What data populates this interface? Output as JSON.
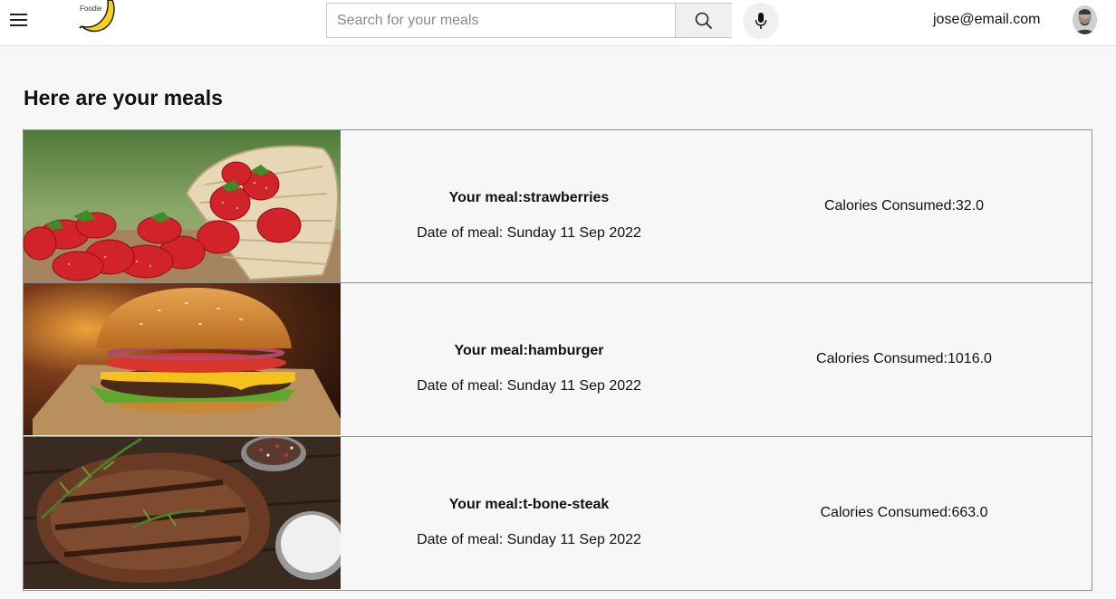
{
  "header": {
    "logo_text": "Foodie",
    "search_placeholder": "Search for your meals",
    "search_value": "",
    "user_email": "jose@email.com"
  },
  "main": {
    "title": "Here are your meals",
    "meals": [
      {
        "name_label": "Your meal:strawberries",
        "date_label": "Date of meal: Sunday 11 Sep 2022",
        "calories_label": "Calories Consumed:32.0"
      },
      {
        "name_label": "Your meal:hamburger",
        "date_label": "Date of meal: Sunday 11 Sep 2022",
        "calories_label": "Calories Consumed:1016.0"
      },
      {
        "name_label": "Your meal:t-bone-steak",
        "date_label": "Date of meal: Sunday 11 Sep 2022",
        "calories_label": "Calories Consumed:663.0"
      }
    ]
  },
  "icons": {
    "menu": "hamburger-menu-icon",
    "logo": "banana-logo",
    "search": "magnifier-icon",
    "mic": "microphone-icon"
  },
  "colors": {
    "background": "#f7f7f7",
    "header": "#ffffff",
    "border": "#8d8d8d",
    "logo_yellow": "#f5d21c"
  }
}
